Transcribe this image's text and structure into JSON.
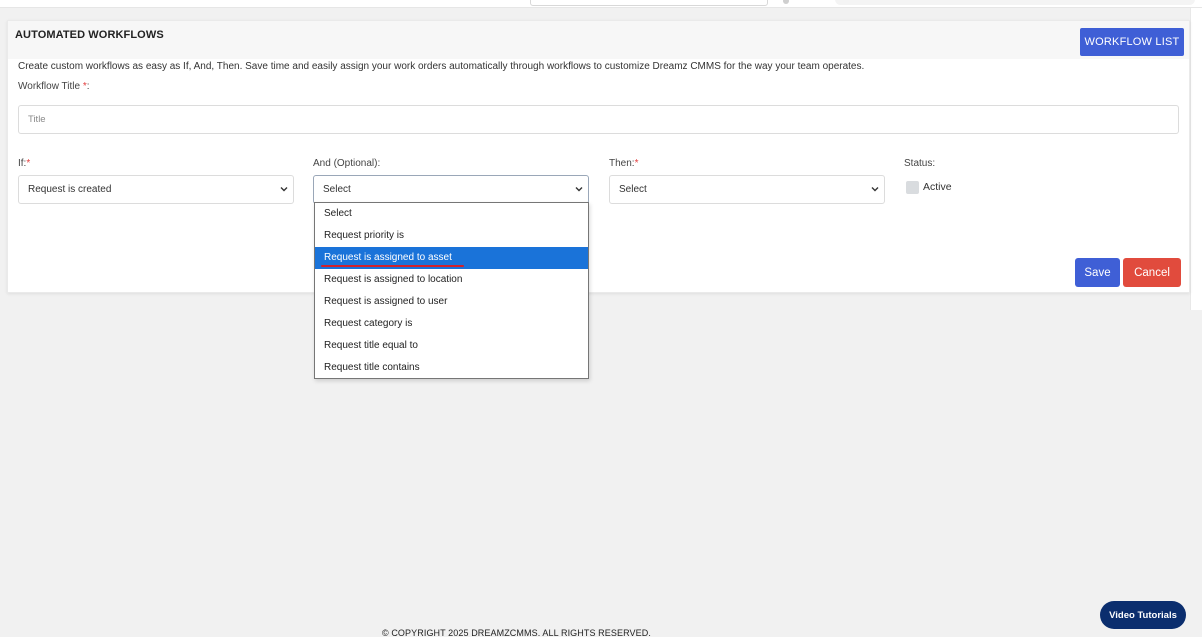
{
  "card": {
    "title": "AUTOMATED WORKFLOWS",
    "workflow_list_label": "WORKFLOW LIST",
    "description": "Create custom workflows as easy as If, And, Then. Save time and easily assign your work orders automatically through workflows to customize Dreamz CMMS for the way your team operates."
  },
  "form": {
    "title_label": "Workflow Title ",
    "title_required": "*",
    "title_suffix": ":",
    "title_placeholder": "Title",
    "title_value": "",
    "if_label": "If:",
    "if_required": "*",
    "if_value": "Request is created",
    "and_label": "And (Optional):",
    "and_value": "Select",
    "then_label": "Then:",
    "then_required": "*",
    "then_value": "Select",
    "status_label": "Status:",
    "active_label": "Active",
    "active_checked": false,
    "save_label": "Save",
    "cancel_label": "Cancel"
  },
  "and_dropdown": {
    "options": [
      "Select",
      "Request priority is",
      "Request is assigned to asset",
      "Request is assigned to location",
      "Request is assigned to user",
      "Request category is",
      "Request title equal to",
      "Request title contains"
    ],
    "highlighted": "Request is assigned to asset"
  },
  "footer": {
    "copyright": "© COPYRIGHT 2025 DREAMZCMMS. ALL RIGHTS RESERVED.",
    "video_tutorials_label": "Video Tutorials"
  },
  "colors": {
    "primary": "#3f5fd6",
    "danger": "#e14b3d",
    "highlight": "#1a73d9",
    "video_button": "#0b2e6e",
    "required_star": "#e23b3b",
    "underline_mark": "#d2212b"
  },
  "icons": {
    "select_chevron": "chevron-down-icon"
  }
}
